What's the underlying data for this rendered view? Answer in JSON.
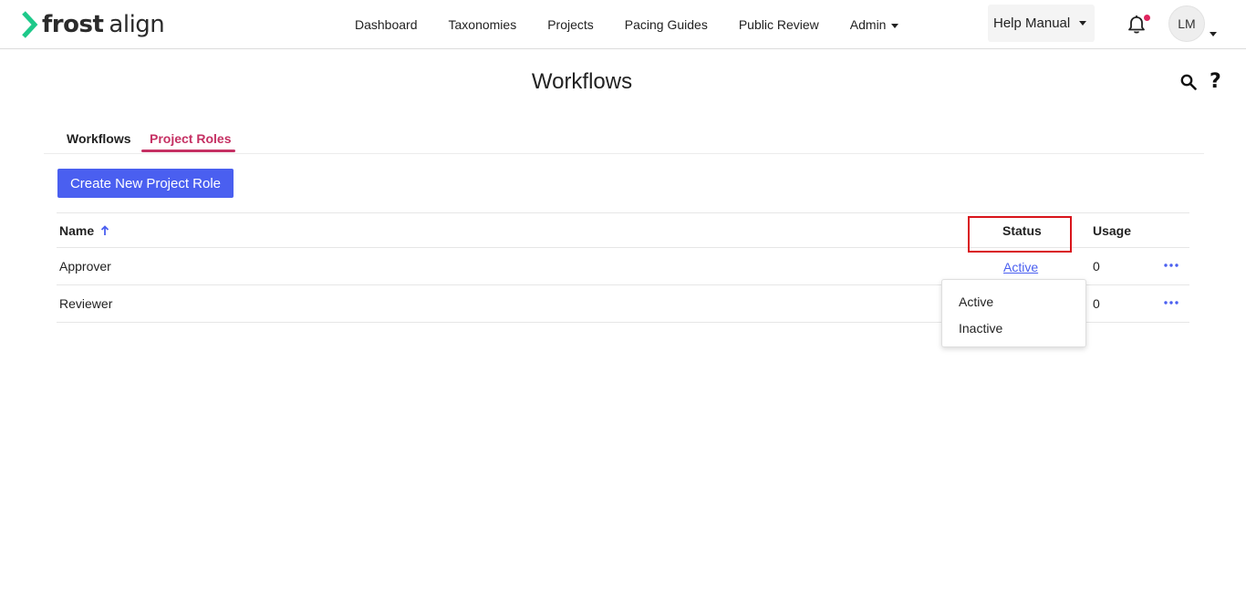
{
  "header": {
    "logo_bold": "frost",
    "logo_light": "align",
    "nav": [
      {
        "label": "Dashboard"
      },
      {
        "label": "Taxonomies"
      },
      {
        "label": "Projects"
      },
      {
        "label": "Pacing Guides"
      },
      {
        "label": "Public Review"
      },
      {
        "label": "Admin"
      }
    ],
    "help_manual": "Help Manual",
    "avatar_initials": "LM"
  },
  "page": {
    "title": "Workflows",
    "help_glyph": "?"
  },
  "tabs": [
    {
      "label": "Workflows",
      "active": false
    },
    {
      "label": "Project Roles",
      "active": true
    }
  ],
  "create_button": "Create New Project Role",
  "table": {
    "columns": {
      "name": "Name",
      "status": "Status",
      "usage": "Usage"
    },
    "rows": [
      {
        "name": "Approver",
        "status": "Active",
        "usage": "0"
      },
      {
        "name": "Reviewer",
        "status": "",
        "usage": "0"
      }
    ]
  },
  "status_dropdown": {
    "options": [
      "Active",
      "Inactive"
    ]
  },
  "colors": {
    "primary": "#4a5ff0",
    "accent": "#c53063",
    "logo_green": "#1ec98a",
    "highlight": "#d9141b",
    "notification": "#e0245e"
  }
}
